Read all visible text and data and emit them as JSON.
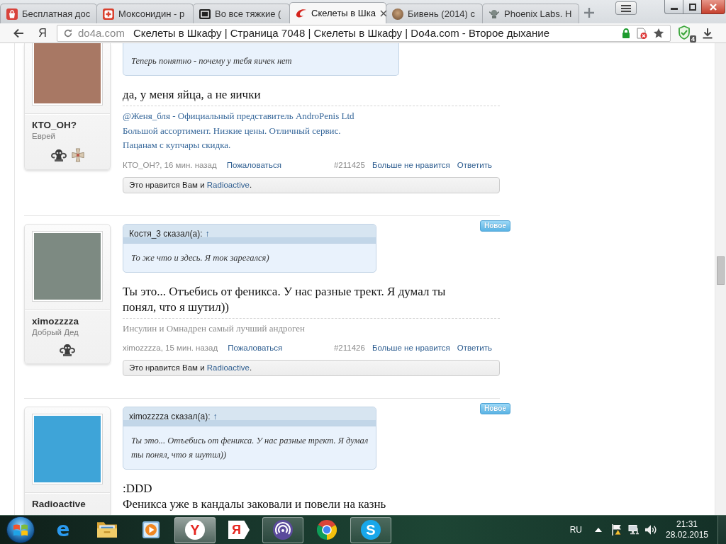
{
  "browser": {
    "tabs": [
      {
        "kind": "bag",
        "title": "Бесплатная дос",
        "selected": false
      },
      {
        "kind": "cross",
        "title": "Моксонидин - р",
        "selected": false
      },
      {
        "kind": "screen",
        "title": "Во все тяжкие (",
        "selected": false
      },
      {
        "kind": "swoosh",
        "title": "Скелеты в Шка",
        "selected": true
      },
      {
        "kind": "thumb",
        "title": "Бивень (2014) с",
        "selected": false
      },
      {
        "kind": "emblem",
        "title": "Phoenix Labs. Н",
        "selected": false
      }
    ],
    "home_button": "Я",
    "address": {
      "domain": "do4a.com",
      "title": "Скелеты в Шкафу | Страница 7048 | Скелеты в Шкафу | Do4a.com - Второе дыхание"
    },
    "extension_badge": "4"
  },
  "posts": [
    {
      "author": "КТО_ОН?",
      "user_title": "Еврей",
      "badges": [
        {
          "kind": "ornament"
        },
        {
          "kind": "cross"
        }
      ],
      "quote": {
        "text": "Теперь понятно - почему у тебя яичек нет"
      },
      "text": "да, у меня яйца, а не яички",
      "signature": {
        "link": true,
        "text": "@Женя_бля - Официальный представитель AndroPenis Ltd\nБольшой ассортимент. Низкие цены. Отличный сервис.\nПацанам с купчары скидка."
      },
      "footer": {
        "byline": "КТО_ОН?, 16 мин. назад",
        "report": "Пожаловаться",
        "number": "#211425",
        "unlike": "Больше не нравится",
        "reply": "Ответить"
      },
      "likes": {
        "prefix": "Это нравится Вам и",
        "user": "Radioactive",
        "suffix": "."
      }
    },
    {
      "badge": "Новое",
      "author": "ximozzzza",
      "user_title": "Добрый Дед",
      "badges": [
        {
          "kind": "ornament"
        }
      ],
      "quote": {
        "header": "Костя_3 сказал(а):",
        "jump": "↑",
        "text": "То же что и здесь. Я ток зарегался)"
      },
      "text": "Ты это... Отъебись от феникса. У нас разные трект. Я думал ты понял, что я шутил))",
      "signature": {
        "link": false,
        "text": "Инсулин и Омнадрен самый лучший андроген"
      },
      "footer": {
        "byline": "ximozzzza, 15 мин. назад",
        "report": "Пожаловаться",
        "number": "#211426",
        "unlike": "Больше не нравится",
        "reply": "Ответить"
      },
      "likes": {
        "prefix": "Это нравится Вам и",
        "user": "Radioactive",
        "suffix": "."
      }
    },
    {
      "badge": "Новое",
      "author": "Radioactive",
      "quote": {
        "header": "ximozzzza сказал(а):",
        "jump": "↑",
        "text": "Ты это... Отъебись от феникса. У нас разные трект. Я думал ты понял, что я шутил))"
      },
      "text": ":DDD\nФеникса уже в кандалы заковали и повели на казнь"
    }
  ],
  "taskbar": {
    "apps": [
      {
        "kind": "ering",
        "glyph": "e",
        "running": false,
        "selected": false
      },
      {
        "kind": "folder",
        "running": false,
        "selected": false
      },
      {
        "kind": "player",
        "running": false,
        "selected": false
      },
      {
        "kind": "ycircle",
        "glyph": "Y",
        "running": true,
        "selected": true
      },
      {
        "kind": "tag",
        "glyph": "Я",
        "running": false,
        "selected": false
      },
      {
        "kind": "spiral",
        "running": true,
        "selected": false
      },
      {
        "kind": "wheel",
        "running": false,
        "selected": false
      },
      {
        "kind": "cloud",
        "glyph": "S",
        "running": true,
        "selected": false
      }
    ],
    "language": "RU",
    "time": "21:31",
    "date": "28.02.2015"
  }
}
